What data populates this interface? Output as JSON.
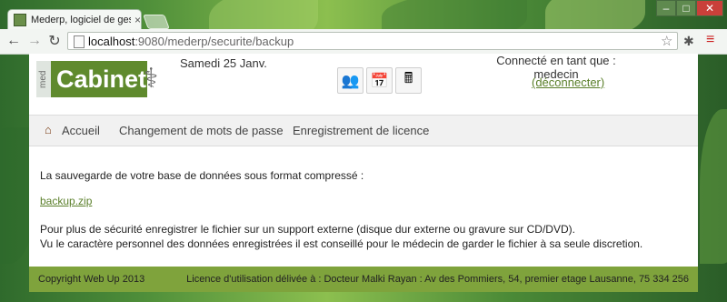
{
  "browser": {
    "tab_title": "Mederp, logiciel de gestion d",
    "tab_close": "×",
    "url_host": "localhost",
    "url_rest": ":9080/mederp/securite/backup",
    "window_controls": {
      "minimize": "–",
      "maximize": "□",
      "close": "✕"
    },
    "nav": {
      "back": "←",
      "forward": "→",
      "reload": "↻"
    },
    "star_icon": "☆",
    "extension_icon": "✱",
    "menu_icon": "≡"
  },
  "header": {
    "logo_small": "med",
    "logo_text": "Cabinet",
    "logo_symbol": "⚕",
    "date": "Samedi 25 Janv.",
    "app_icons": [
      "👥",
      "📅",
      "🖩"
    ],
    "user_line": "Connecté en tant que : medecin",
    "logout": "(déconnecter)"
  },
  "menu": {
    "home": "Accueil",
    "change_password": "Changement de mots de passe",
    "licence_registration": "Enregistrement de licence"
  },
  "content": {
    "intro": "La sauvegarde de votre base de données sous format compressé :",
    "backup_link": "backup.zip",
    "advice1": "Pour plus de sécurité enregistrer le fichier sur un support externe (disque dur externe ou gravure sur CD/DVD).",
    "advice2": "Vu le caractère personnel des données enregistrées il est conseillé pour le médecin de garder le fichier à sa seule discretion."
  },
  "footer": {
    "copyright": "Copyright Web Up 2013",
    "licence": "Licence d'utilisation délivée à : Docteur Malki Rayan : Av des Pommiers, 54, premier etage Lausanne, 75 334 256"
  },
  "colors": {
    "accent": "#7fa33c",
    "link": "#5a7f2a",
    "logo": "#5f8a2d"
  }
}
